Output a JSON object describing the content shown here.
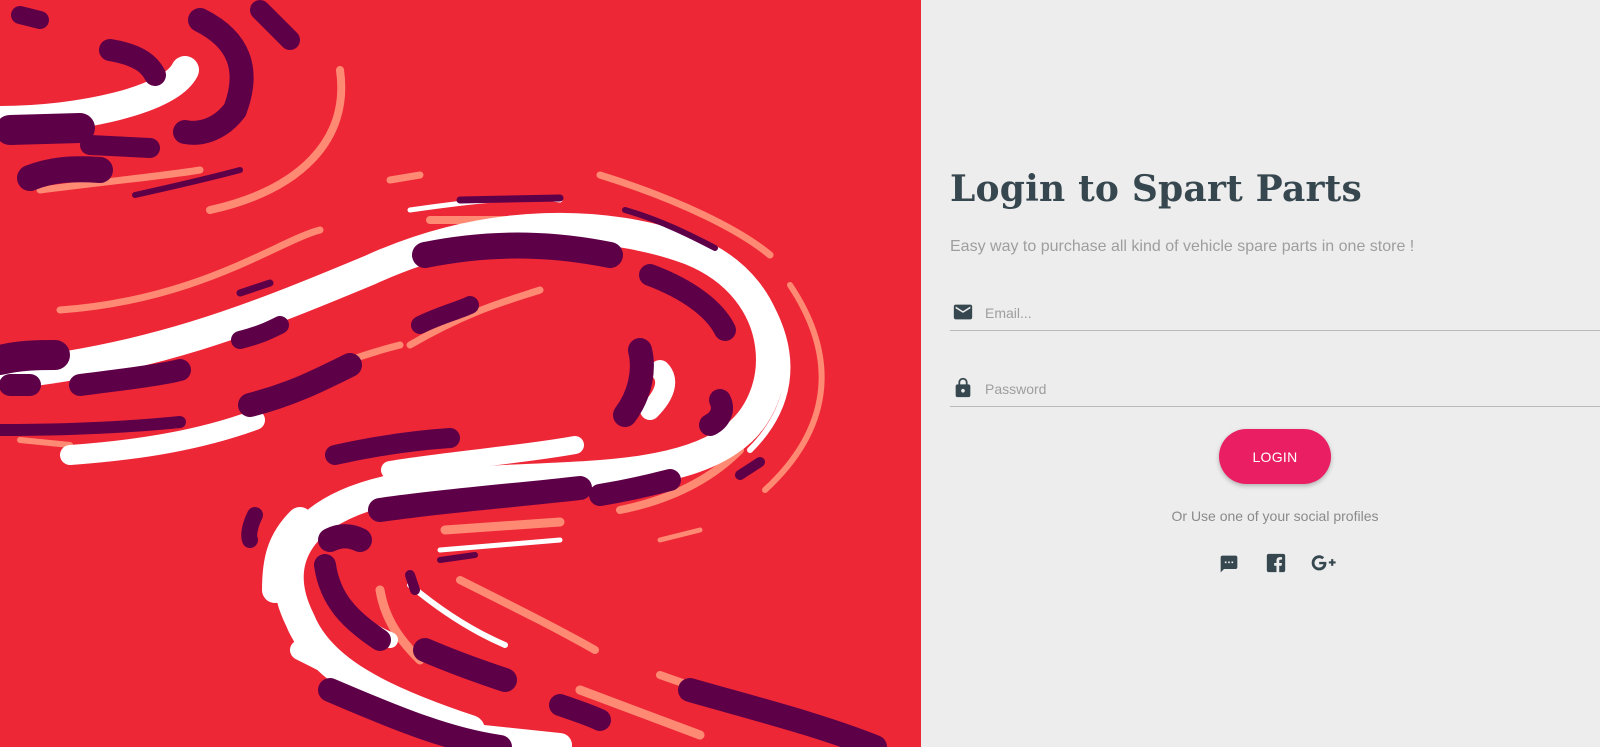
{
  "art": {
    "colors": {
      "background": "#ee2737",
      "white": "#ffffff",
      "plum": "#5e0048",
      "salmon": "#ff8a73"
    }
  },
  "login": {
    "title": "Login to Spart Parts",
    "subtitle": "Easy way to purchase all kind of vehicle spare parts in one store !",
    "email": {
      "placeholder": "Email...",
      "value": "",
      "icon": "mail-icon"
    },
    "password": {
      "placeholder": "Password",
      "value": "",
      "icon": "lock-icon"
    },
    "login_button": "LOGIN",
    "social_caption": "Or Use one of your social profiles",
    "social_icons": [
      "chat-icon",
      "facebook-icon",
      "google-plus-icon"
    ]
  },
  "colors": {
    "accent": "#e91e63",
    "title": "#37474f",
    "muted": "#9e9e9e",
    "panel": "#ededed"
  }
}
